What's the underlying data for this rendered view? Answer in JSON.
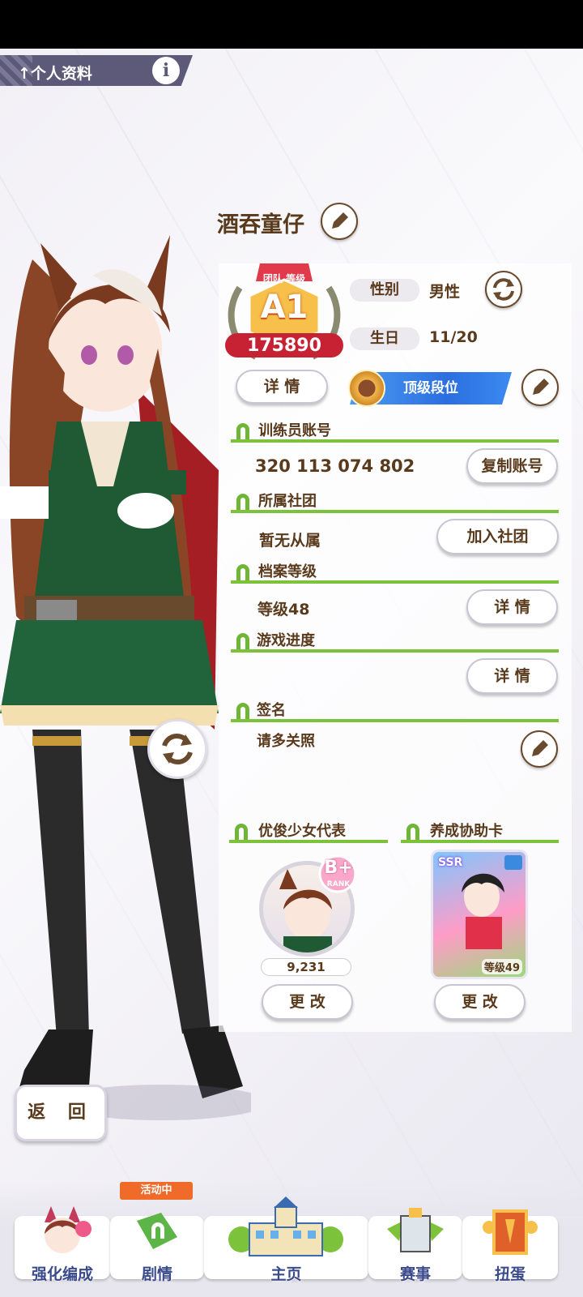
{
  "header": {
    "title": "个人资料",
    "info_label": "i"
  },
  "profile": {
    "name": "酒吞童仔",
    "team_rank": {
      "caption": "团队 等级",
      "grade": "A1",
      "score": "175890"
    },
    "gender_label": "性别",
    "gender_value": "男性",
    "birthday_label": "生日",
    "birthday_value": "11/20",
    "detail_button": "详 情",
    "top_rank_label": "顶级段位"
  },
  "sections": {
    "account": {
      "title": "训练员账号",
      "value": "320 113 074 802",
      "button": "复制账号"
    },
    "club": {
      "title": "所属社团",
      "value": "暂无从属",
      "button": "加入社团"
    },
    "archive": {
      "title": "档案等级",
      "value": "等级48",
      "button": "详 情"
    },
    "progress": {
      "title": "游戏进度",
      "button": "详 情"
    },
    "signature": {
      "title": "签名",
      "value": "请多关照"
    }
  },
  "representative": {
    "title": "优俊少女代表",
    "rank": "B+",
    "rank_caption": "RANK",
    "score": "9,231",
    "button": "更 改"
  },
  "support_card": {
    "title": "养成协助卡",
    "rarity": "SSR",
    "level": "等级49",
    "button": "更 改"
  },
  "back_button": "返 回",
  "nav": {
    "event_tag": "活动中",
    "items": [
      {
        "label": "强化编成"
      },
      {
        "label": "剧情"
      },
      {
        "label": "主页"
      },
      {
        "label": "赛事"
      },
      {
        "label": "扭蛋"
      }
    ]
  }
}
